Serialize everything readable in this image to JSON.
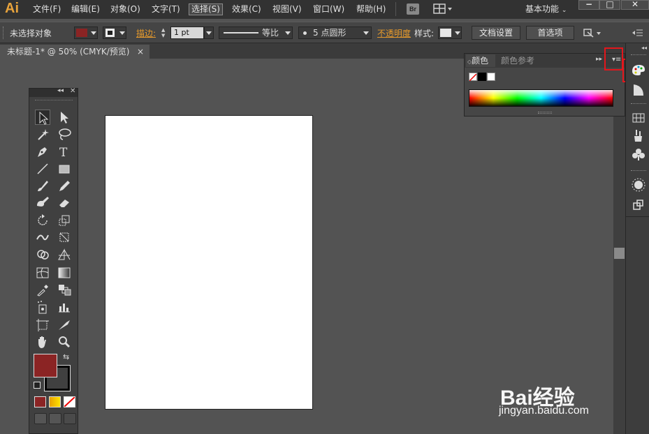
{
  "app": {
    "logo": "Ai"
  },
  "menu": {
    "items": [
      "文件(F)",
      "编辑(E)",
      "对象(O)",
      "文字(T)",
      "选择(S)",
      "效果(C)",
      "视图(V)",
      "窗口(W)",
      "帮助(H)"
    ],
    "selected": "选择(S)",
    "bridge_badge": "Br",
    "workspace": "基本功能"
  },
  "control_bar": {
    "selection_label": "未选择对象",
    "fill_color": "#8b2424",
    "stroke_label": "描边:",
    "stroke_weight": "1 pt",
    "stroke_profile": "等比",
    "brush": "5 点圆形",
    "opacity_label": "不透明度",
    "style_label": "样式:",
    "doc_setup_button": "文档设置",
    "preferences_button": "首选项"
  },
  "document": {
    "tab_title": "未标题-1* @ 50% (CMYK/预览)",
    "close": "×"
  },
  "color_panel": {
    "tabs": [
      "颜色",
      "颜色参考"
    ],
    "active_tab": "颜色"
  },
  "tools": {
    "fill_color": "#8b2424",
    "stroke_color": "#000000"
  },
  "highlight_color": "#e3161c",
  "watermark": {
    "line1": "Bai经验",
    "line2": "jingyan.baidu.com"
  }
}
